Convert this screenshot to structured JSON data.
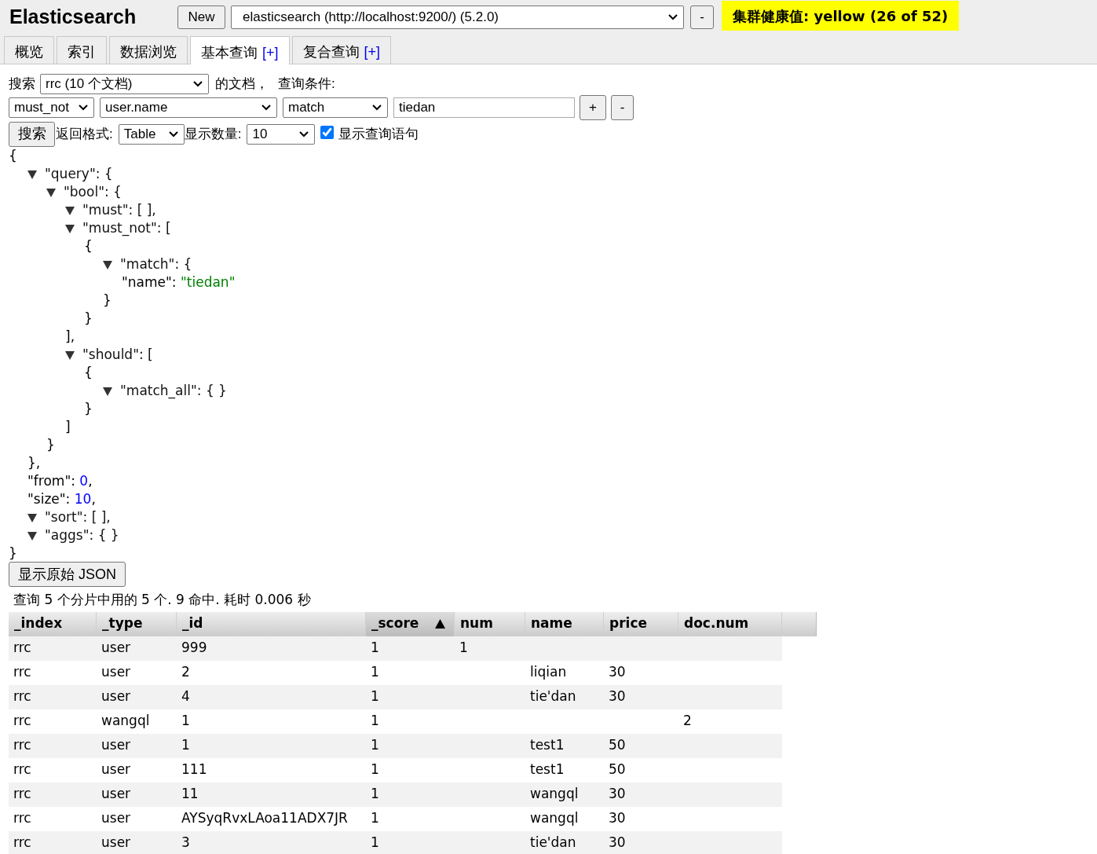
{
  "header": {
    "title": "Elasticsearch",
    "new_button": "New",
    "connection": "elasticsearch (http://localhost:9200/) (5.2.0)",
    "remove_button": "-",
    "health": "集群健康值: yellow (26 of 52)"
  },
  "tabs": [
    {
      "label": "概览",
      "selected": false
    },
    {
      "label": "索引",
      "selected": false
    },
    {
      "label": "数据浏览",
      "selected": false
    },
    {
      "label": "基本查询",
      "plus": "[+]",
      "selected": true
    },
    {
      "label": "复合查询",
      "plus": "[+]",
      "selected": false
    }
  ],
  "query_form": {
    "search_label": "搜索",
    "index": "rrc (10 个文档)",
    "docs_label": "的文档，",
    "condition_label": "查询条件:",
    "clause": {
      "occur": "must_not",
      "field": "user.name",
      "operator": "match",
      "value": "tiedan",
      "add": "+",
      "remove": "-"
    },
    "search_button": "搜索",
    "format_label": "返回格式:",
    "format": "Table",
    "size_label": "显示数量:",
    "size": "10",
    "show_query": {
      "label": "显示查询语句",
      "checked": true
    }
  },
  "query_view": {
    "kind": "block",
    "open": "{",
    "close": "}",
    "children": [
      {
        "kind": "collapsible",
        "expanded": true,
        "open": "\"query\": {",
        "close": "},",
        "children": [
          {
            "kind": "collapsible",
            "expanded": true,
            "open": "\"bool\": {",
            "close": "}",
            "children": [
              {
                "kind": "collapsible",
                "expanded": true,
                "open": "\"must\": [ ],"
              },
              {
                "kind": "collapsible",
                "expanded": true,
                "open": "\"must_not\": [",
                "close": "],",
                "children": [
                  {
                    "kind": "block",
                    "open": "{",
                    "close": "}",
                    "children": [
                      {
                        "kind": "collapsible",
                        "expanded": true,
                        "open": "\"match\": {",
                        "close": "}",
                        "children": [
                          {
                            "kind": "string",
                            "key": "\"name\": ",
                            "value": "\"tiedan\""
                          }
                        ]
                      }
                    ]
                  }
                ]
              },
              {
                "kind": "collapsible",
                "expanded": true,
                "open": "\"should\": [",
                "close": "]",
                "children": [
                  {
                    "kind": "block",
                    "open": "{",
                    "close": "}",
                    "children": [
                      {
                        "kind": "collapsible",
                        "expanded": true,
                        "open": "\"match_all\": { }"
                      }
                    ]
                  }
                ]
              }
            ]
          }
        ]
      },
      {
        "kind": "number",
        "key": "\"from\": ",
        "value": "0",
        "suffix": ","
      },
      {
        "kind": "number",
        "key": "\"size\": ",
        "value": "10",
        "suffix": ","
      },
      {
        "kind": "collapsible",
        "expanded": true,
        "open": "\"sort\": [ ],"
      },
      {
        "kind": "collapsible",
        "expanded": true,
        "open": "\"aggs\": { }"
      }
    ]
  },
  "raw_json_button": "显示原始 JSON",
  "summary": "查询 5 个分片中用的 5 个. 9 命中. 耗时 0.006 秒",
  "table": {
    "columns": [
      {
        "label": "_index",
        "sorted": false
      },
      {
        "label": "_type",
        "sorted": false
      },
      {
        "label": "_id",
        "sorted": false
      },
      {
        "label": "_score",
        "sorted": true
      },
      {
        "label": "num",
        "sorted": false
      },
      {
        "label": "name",
        "sorted": false
      },
      {
        "label": "price",
        "sorted": false
      },
      {
        "label": "doc.num",
        "sorted": false
      }
    ],
    "rows": [
      [
        "rrc",
        "user",
        "999",
        "1",
        "1",
        null,
        null,
        null
      ],
      [
        "rrc",
        "user",
        "2",
        "1",
        null,
        "liqian",
        "30",
        null
      ],
      [
        "rrc",
        "user",
        "4",
        "1",
        null,
        "tie'dan",
        "30",
        null
      ],
      [
        "rrc",
        "wangql",
        "1",
        "1",
        null,
        null,
        null,
        "2"
      ],
      [
        "rrc",
        "user",
        "1",
        "1",
        null,
        "test1",
        "50",
        null
      ],
      [
        "rrc",
        "user",
        "111",
        "1",
        null,
        "test1",
        "50",
        null
      ],
      [
        "rrc",
        "user",
        "11",
        "1",
        null,
        "wangql",
        "30",
        null
      ],
      [
        "rrc",
        "user",
        "AYSyqRvxLAoa11ADX7JR",
        "1",
        null,
        "wangql",
        "30",
        null
      ],
      [
        "rrc",
        "user",
        "3",
        "1",
        null,
        "tie'dan",
        "30",
        null
      ]
    ]
  }
}
